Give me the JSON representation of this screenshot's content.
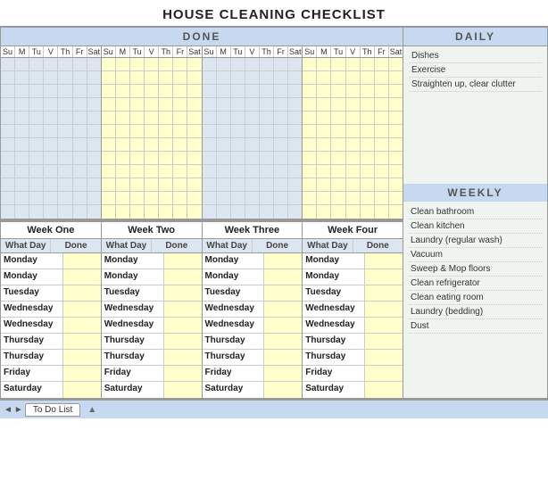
{
  "title": "HOUSE CLEANING CHECKLIST",
  "done_header": "DONE",
  "daily_header": "DAILY",
  "weekly_header": "WEEKLY",
  "days": [
    "Su",
    "M",
    "Tu",
    "V",
    "Th",
    "Fr",
    "Sat"
  ],
  "week_labels": [
    "Week One",
    "Week Two",
    "Week Three",
    "Week Four"
  ],
  "schedule_columns": [
    {
      "week": "Week One",
      "headers": [
        "What Day",
        "Done"
      ],
      "rows": [
        {
          "day": "Monday",
          "done": ""
        },
        {
          "day": "Monday",
          "done": ""
        },
        {
          "day": "Tuesday",
          "done": ""
        },
        {
          "day": "Wednesday",
          "done": ""
        },
        {
          "day": "Wednesday",
          "done": ""
        },
        {
          "day": "Thursday",
          "done": ""
        },
        {
          "day": "Thursday",
          "done": ""
        },
        {
          "day": "Friday",
          "done": ""
        },
        {
          "day": "Saturday",
          "done": ""
        }
      ]
    },
    {
      "week": "Week Two",
      "headers": [
        "What Day",
        "Done"
      ],
      "rows": [
        {
          "day": "Monday",
          "done": ""
        },
        {
          "day": "Monday",
          "done": ""
        },
        {
          "day": "Tuesday",
          "done": ""
        },
        {
          "day": "Wednesday",
          "done": ""
        },
        {
          "day": "Wednesday",
          "done": ""
        },
        {
          "day": "Thursday",
          "done": ""
        },
        {
          "day": "Thursday",
          "done": ""
        },
        {
          "day": "Friday",
          "done": ""
        },
        {
          "day": "Saturday",
          "done": ""
        }
      ]
    },
    {
      "week": "Week Three",
      "headers": [
        "What Day",
        "Done"
      ],
      "rows": [
        {
          "day": "Monday",
          "done": ""
        },
        {
          "day": "Monday",
          "done": ""
        },
        {
          "day": "Tuesday",
          "done": ""
        },
        {
          "day": "Wednesday",
          "done": ""
        },
        {
          "day": "Wednesday",
          "done": ""
        },
        {
          "day": "Thursday",
          "done": ""
        },
        {
          "day": "Thursday",
          "done": ""
        },
        {
          "day": "Friday",
          "done": ""
        },
        {
          "day": "Saturday",
          "done": ""
        }
      ]
    },
    {
      "week": "Week Four",
      "headers": [
        "What Day",
        "Done"
      ],
      "rows": [
        {
          "day": "Monday",
          "done": ""
        },
        {
          "day": "Monday",
          "done": ""
        },
        {
          "day": "Tuesday",
          "done": ""
        },
        {
          "day": "Wednesday",
          "done": ""
        },
        {
          "day": "Wednesday",
          "done": ""
        },
        {
          "day": "Thursday",
          "done": ""
        },
        {
          "day": "Thursday",
          "done": ""
        },
        {
          "day": "Friday",
          "done": ""
        },
        {
          "day": "Saturday",
          "done": ""
        }
      ]
    }
  ],
  "daily_items": [
    "Dishes",
    "Exercise",
    "Straighten up, clear clutter"
  ],
  "weekly_items": [
    "Clean bathroom",
    "Clean kitchen",
    "Laundry (regular wash)",
    "Vacuum",
    "Sweep & Mop floors",
    "Clean refrigerator",
    "Clean eating room",
    "Laundry (bedding)",
    "Dust"
  ],
  "bottom_tab": "To Do List",
  "grid_rows": 12
}
